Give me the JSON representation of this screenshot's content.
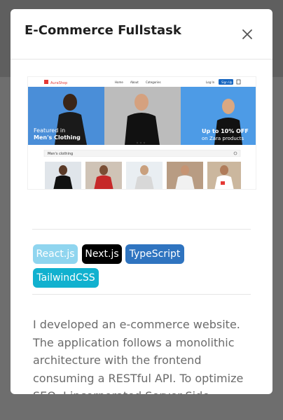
{
  "modal": {
    "title": "E-Commerce Fullstask",
    "close_icon": "close-icon"
  },
  "preview": {
    "brand": "AuraShop",
    "nav_links": [
      "Home",
      "About",
      "Categories"
    ],
    "login": "Log In",
    "signup": "Sign Up",
    "hero_left_line1": "Featured in",
    "hero_left_line2": "Men's Clothing",
    "hero_right_line1": "Up to 10% OFF",
    "hero_right_line2": "on Zara products",
    "section_title": "Men's clothing",
    "accent": "#e53935"
  },
  "tags": [
    {
      "label": "React.js",
      "bg": "#8fd5ef",
      "fg": "#ffffff"
    },
    {
      "label": "Next.js",
      "bg": "#000000",
      "fg": "#ffffff"
    },
    {
      "label": "TypeScript",
      "bg": "#2f74c0",
      "fg": "#ffffff"
    },
    {
      "label": "TailwindCSS",
      "bg": "#11b1cf",
      "fg": "#ffffff"
    }
  ],
  "description": "I developed an e-commerce website. The application follows a monolithic architecture with the frontend consuming a RESTful API. To optimize SEO, I incorporated Server-Side Rendering (SSR)"
}
